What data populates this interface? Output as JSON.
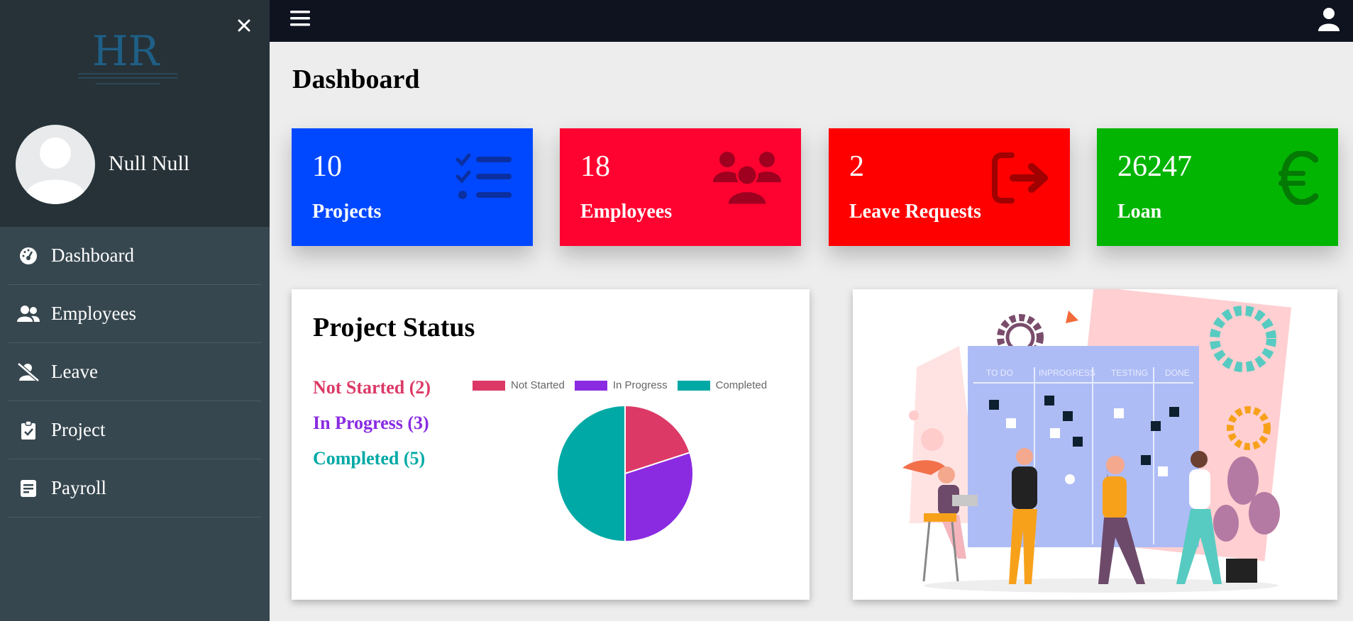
{
  "sidebar": {
    "logo_text": "HR",
    "user_name": "Null Null",
    "items": [
      {
        "label": "Dashboard",
        "icon": "tachometer-icon"
      },
      {
        "label": "Employees",
        "icon": "users-icon"
      },
      {
        "label": "Leave",
        "icon": "user-slash-icon"
      },
      {
        "label": "Project",
        "icon": "clipboard-check-icon"
      },
      {
        "label": "Payroll",
        "icon": "file-invoice-icon"
      }
    ]
  },
  "header": {
    "title": "Dashboard"
  },
  "cards": [
    {
      "value": "10",
      "label": "Projects",
      "color": "#0048ff",
      "icon": "task-list-icon"
    },
    {
      "value": "18",
      "label": "Employees",
      "color": "#ff0330",
      "icon": "users-icon"
    },
    {
      "value": "2",
      "label": "Leave Requests",
      "color": "#ff0000",
      "icon": "sign-out-icon"
    },
    {
      "value": "26247",
      "label": "Loan",
      "color": "#03b503",
      "icon": "euro-icon"
    }
  ],
  "project_status": {
    "title": "Project Status",
    "lines": [
      "Not Started (2)",
      "In Progress (3)",
      "Completed (5)"
    ]
  },
  "chart_data": {
    "type": "pie",
    "categories": [
      "Not Started",
      "In Progress",
      "Completed"
    ],
    "values": [
      2,
      3,
      5
    ],
    "colors": [
      "#dc3966",
      "#8a2be2",
      "#00a9a5"
    ],
    "legend": "top"
  }
}
